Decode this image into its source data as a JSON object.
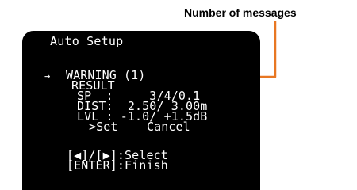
{
  "callout": {
    "label": "Number of messages",
    "color": "#e87722"
  },
  "screen": {
    "title": "Auto Setup",
    "cursor_icon": "arrow-right",
    "warning": "WARNING (1)",
    "result": "RESULT",
    "sp": "SP  :     3/4/0.1",
    "dist": "DIST:  2.50/ 3.00m",
    "lvl": "LVL : -1.0/ +1.5dB",
    "set": ">Set",
    "cancel": "Cancel",
    "select_hint": "[◀]/[▶]:Select",
    "finish_hint": "[ENTER]:Finish"
  }
}
